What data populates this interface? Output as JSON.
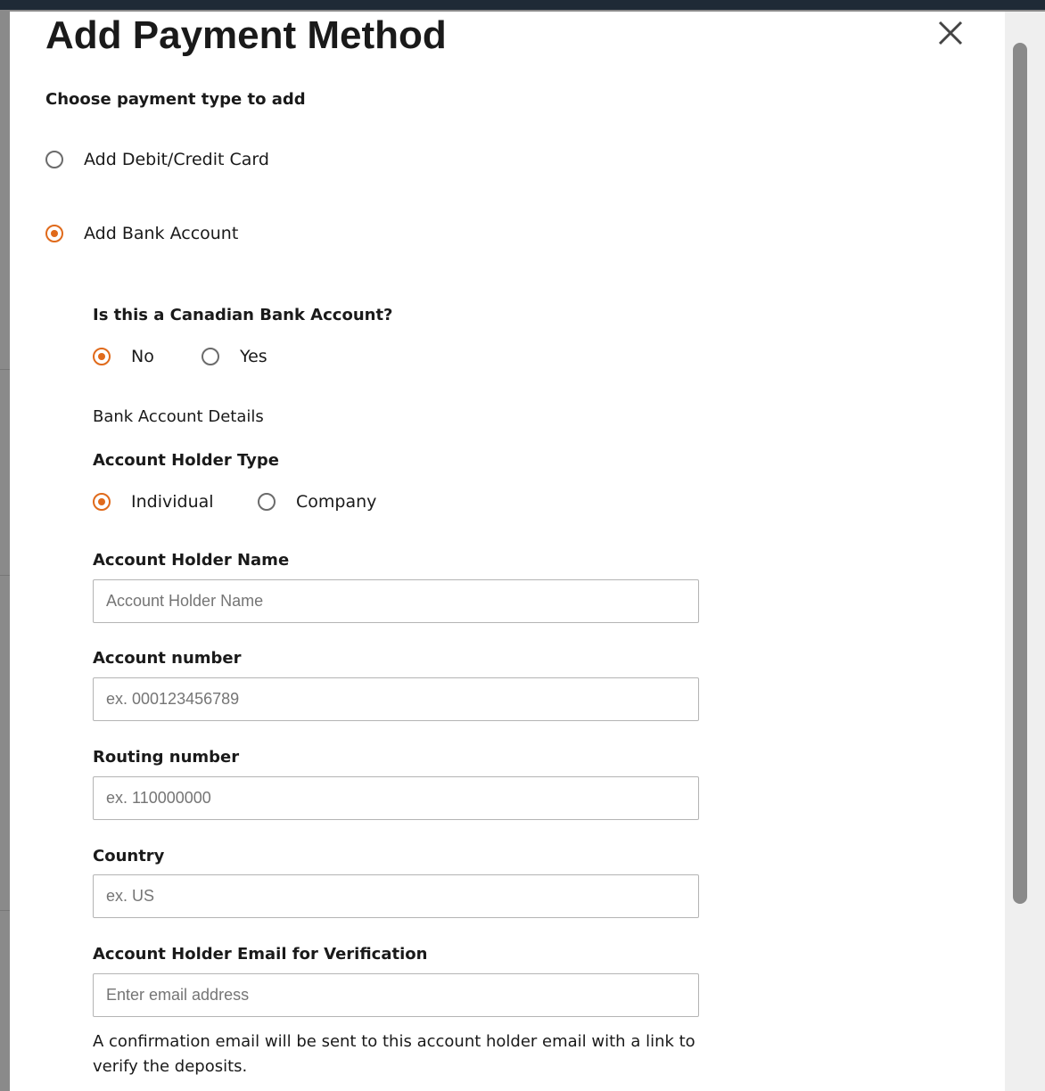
{
  "modal": {
    "title": "Add Payment Method",
    "close_label": "×",
    "payment_type_prompt": "Choose payment type to add",
    "payment_types": [
      {
        "label": "Add Debit/Credit Card",
        "selected": false
      },
      {
        "label": "Add Bank Account",
        "selected": true
      }
    ],
    "canadian_question": "Is this a Canadian Bank Account?",
    "canadian_options": [
      {
        "label": "No",
        "selected": true
      },
      {
        "label": "Yes",
        "selected": false
      }
    ],
    "section_heading": "Bank Account Details",
    "holder_type_label": "Account Holder Type",
    "holder_type_options": [
      {
        "label": "Individual",
        "selected": true
      },
      {
        "label": "Company",
        "selected": false
      }
    ],
    "fields": {
      "holder_name": {
        "label": "Account Holder Name",
        "placeholder": "Account Holder Name",
        "value": ""
      },
      "account_number": {
        "label": "Account number",
        "placeholder": "ex. 000123456789",
        "value": ""
      },
      "routing_number": {
        "label": "Routing number",
        "placeholder": "ex. 110000000",
        "value": ""
      },
      "country": {
        "label": "Country",
        "placeholder": "ex. US",
        "value": ""
      },
      "email": {
        "label": "Account Holder Email for Verification",
        "placeholder": "Enter email address",
        "value": ""
      }
    },
    "confirmation_note": "A confirmation email will be sent to this account holder email with a link to verify the deposits."
  },
  "colors": {
    "accent": "#e06a1b",
    "overlay": "#8a8a8a",
    "modal_bg": "#ffffff",
    "topbar": "#1f2a36"
  }
}
